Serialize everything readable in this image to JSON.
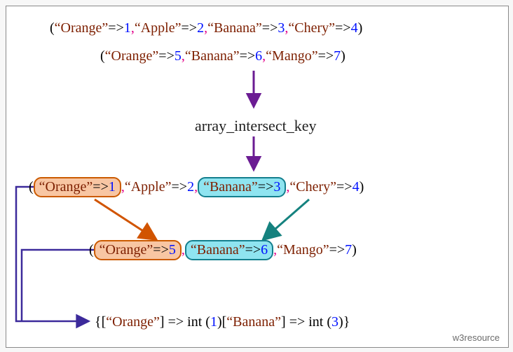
{
  "function_name": "array_intersect_key",
  "p": "(",
  "cp": ")",
  "ob": "{",
  "cb": "}",
  "obk": "[",
  "cbk": "]",
  "arrow": "=>",
  "comma": ",",
  "int_label": "int",
  "keys": {
    "orange": "“Orange”",
    "apple": "“Apple”",
    "banana": "“Banana”",
    "cherry": "“Chery”",
    "mango": "“Mango”"
  },
  "vals": {
    "v1": "1",
    "v2": "2",
    "v3": "3",
    "v4": "4",
    "v5": "5",
    "v6": "6",
    "v7": "7"
  },
  "watermark": "w3resource",
  "chart_data": {
    "type": "table",
    "title": "array_intersect_key example",
    "array1": {
      "Orange": 1,
      "Apple": 2,
      "Banana": 3,
      "Chery": 4
    },
    "array2": {
      "Orange": 5,
      "Banana": 6,
      "Mango": 7
    },
    "result": {
      "Orange": 1,
      "Banana": 3
    }
  }
}
